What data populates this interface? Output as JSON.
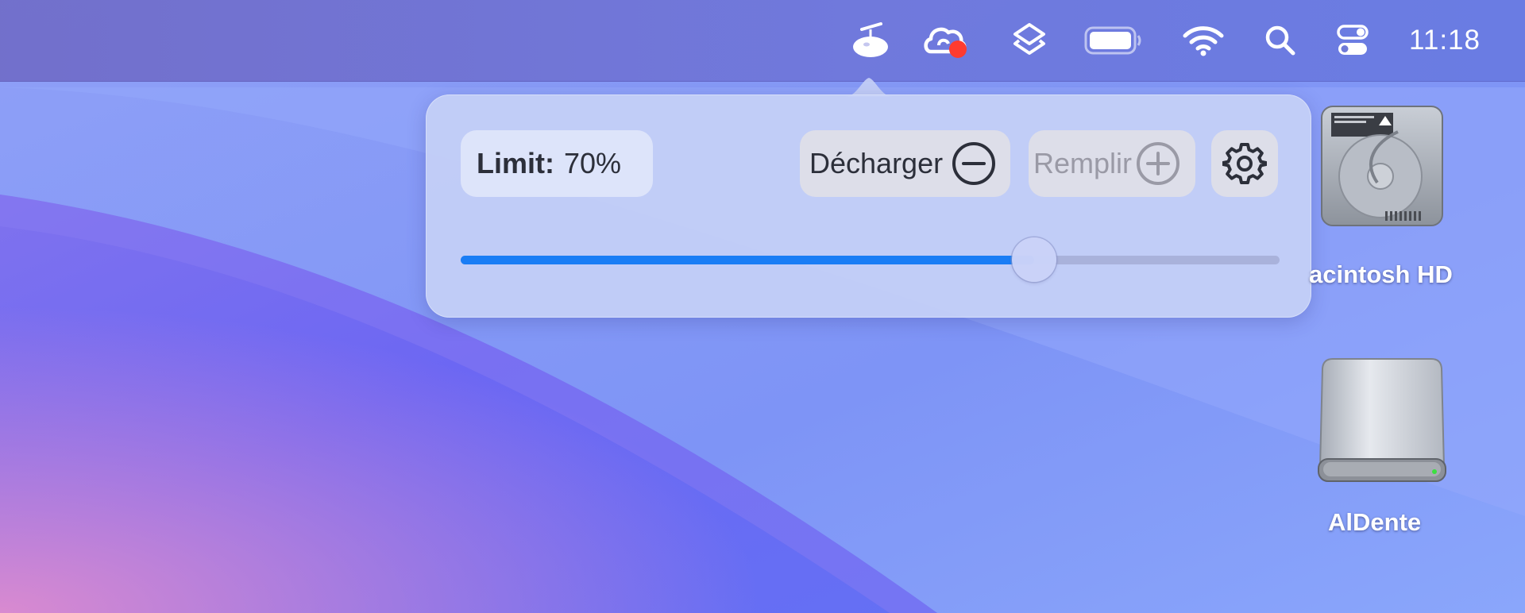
{
  "menubar": {
    "items": [
      {
        "id": "aldente",
        "icon": "aldente-icon"
      },
      {
        "id": "creative-cloud",
        "icon": "creative-cloud-icon",
        "badge_color": "#ff3b2f"
      },
      {
        "id": "shortcuts",
        "icon": "layers-icon"
      },
      {
        "id": "battery",
        "icon": "battery-icon"
      },
      {
        "id": "wifi",
        "icon": "wifi-icon"
      },
      {
        "id": "spotlight",
        "icon": "search-icon"
      },
      {
        "id": "control-center",
        "icon": "control-center-icon"
      }
    ],
    "clock": "11:18"
  },
  "popover": {
    "limit_label": "Limit:",
    "limit_value": "70%",
    "discharge_label": "Décharger",
    "fill_label": "Remplir",
    "slider_value_percent": 70,
    "accent_color": "#1a7df5"
  },
  "desktop": {
    "icons": [
      {
        "label": "acintosh HD",
        "icon": "hard-drive-icon"
      },
      {
        "label": "AlDente",
        "icon": "external-drive-icon"
      }
    ]
  }
}
